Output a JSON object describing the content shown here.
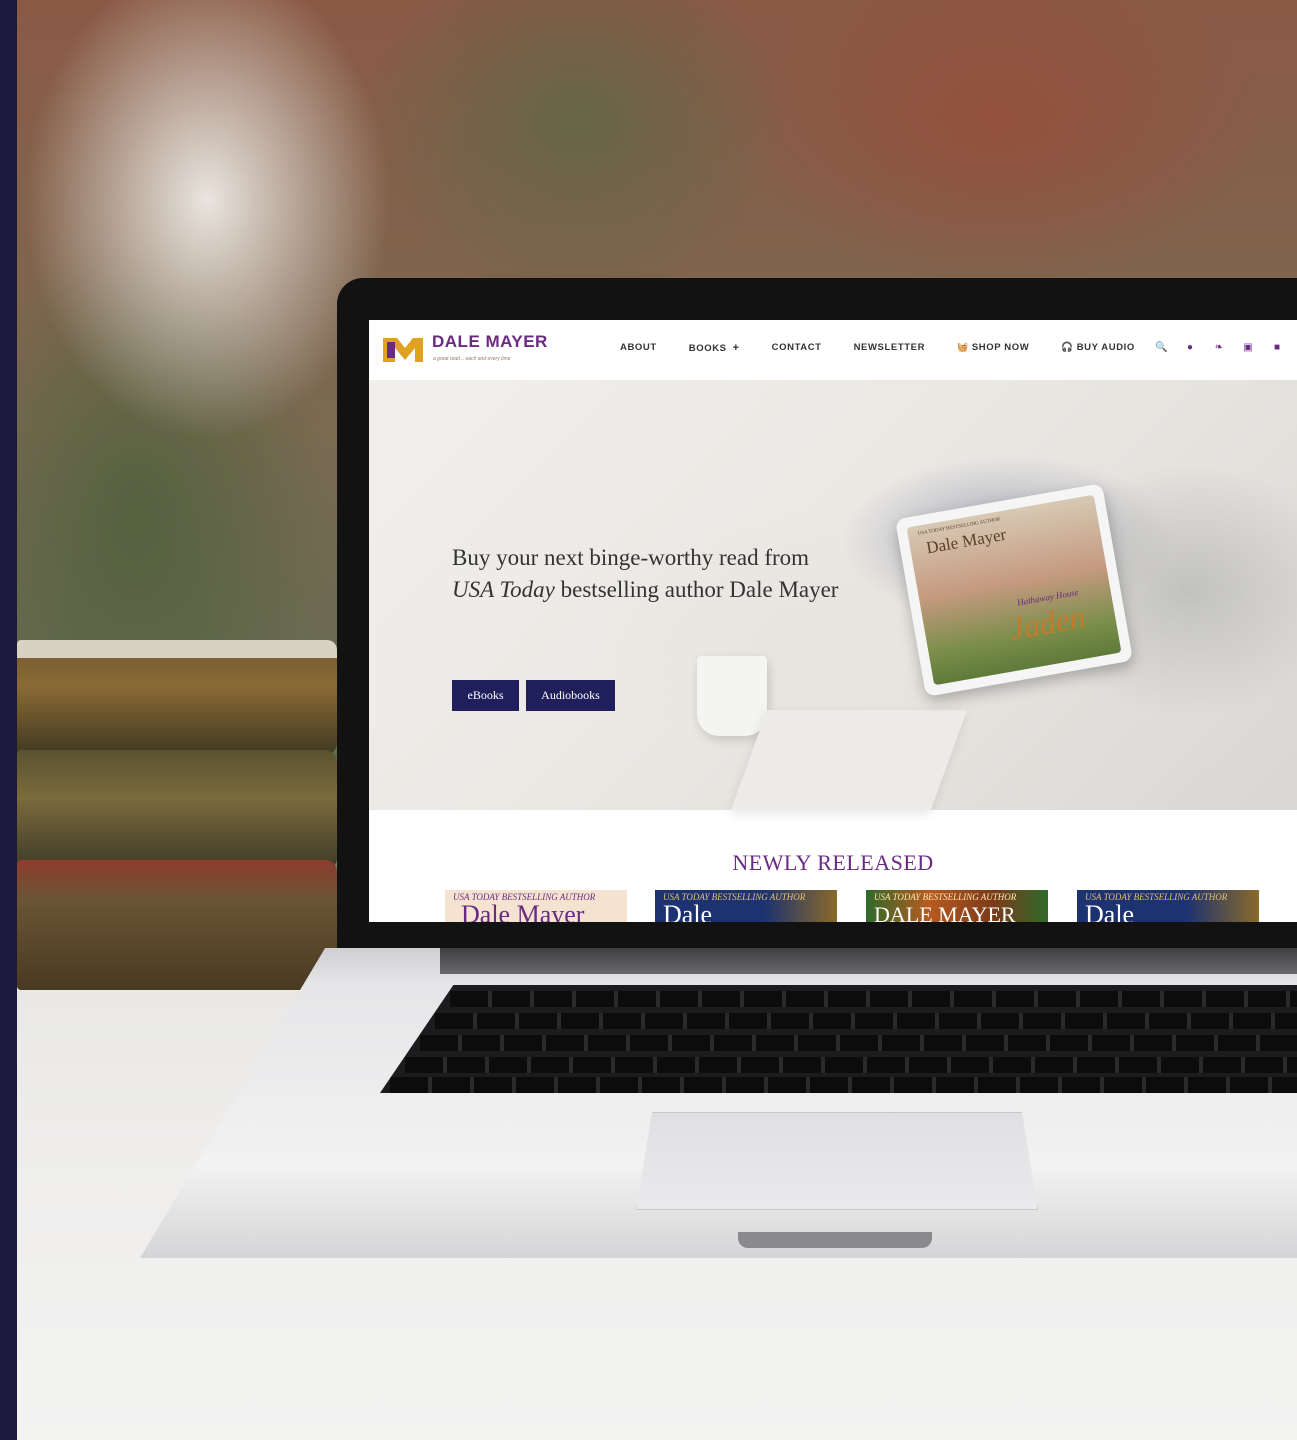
{
  "site": {
    "logo_name": "DALE MAYER",
    "logo_tagline": "a great read... each and every time",
    "colors": {
      "brand": "#6b2a82",
      "button": "#1f1f5c",
      "logo_gold": "#e0a020"
    }
  },
  "nav": {
    "items": [
      "ABOUT",
      "BOOKS",
      "CONTACT",
      "NEWSLETTER",
      "SHOP NOW",
      "BUY AUDIO"
    ],
    "books_suffix": "+",
    "icons": [
      "search-icon",
      "facebook-icon",
      "twitter-icon",
      "instagram-icon",
      "bookbub-icon"
    ]
  },
  "hero": {
    "line1": "Buy your next binge-worthy read from",
    "line2_em": "USA Today",
    "line2_rest": " bestselling author Dale Mayer",
    "buttons": [
      "eBooks",
      "Audiobooks"
    ],
    "tablet_cover": {
      "author_tag": "USA TODAY BESTSELLING AUTHOR",
      "author": "Dale Mayer",
      "series": "Hathaway House",
      "title": "Jaden"
    }
  },
  "newly_released": {
    "heading": "NEWLY RELEASED",
    "covers": [
      {
        "tag": "USA TODAY BESTSELLING AUTHOR",
        "author": "Dale Mayer",
        "bg": "#f3e3d0",
        "fg": "#6b2a82"
      },
      {
        "tag": "USA TODAY BESTSELLING AUTHOR",
        "author": "Dale",
        "bg": "#1d3270",
        "fg": "#ffffff"
      },
      {
        "tag": "USA TODAY BESTSELLING AUTHOR",
        "author": "DALE MAYER",
        "bg": "#7a3a1a",
        "fg": "#ffffff"
      },
      {
        "tag": "USA TODAY BESTSELLING AUTHOR",
        "author": "Dale",
        "bg": "#1d3270",
        "fg": "#ffffff"
      }
    ]
  }
}
